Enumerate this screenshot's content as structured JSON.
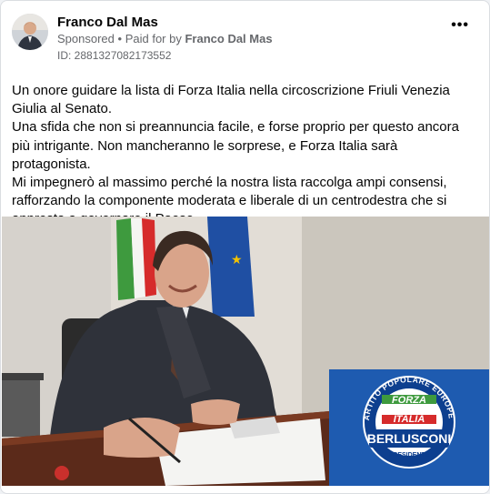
{
  "post": {
    "author": "Franco Dal Mas",
    "sponsored_label": "Sponsored",
    "separator": "•",
    "paid_for_label": "Paid for by",
    "paid_for_name": "Franco Dal Mas",
    "ad_id": "ID: 2881327082173552",
    "more_icon": "more-options-icon",
    "text_lines": [
      "Un onore guidare la lista di Forza Italia nella circoscrizione Friuli Venezia Giulia al Senato.",
      "Una sfida che non si preannuncia facile, e forse proprio per questo ancora più intrigante. Non mancheranno le sorprese, e Forza Italia sarà protagonista.",
      "Mi impegnerò al massimo perché la nostra lista raccolga ampi consensi, rafforzando la componente moderata e liberale di un centrodestra che si appresta a governare il Paese.…"
    ]
  },
  "logo": {
    "ring_text": "PARTITO POPOLARE EUROPEO",
    "forza": "FORZA",
    "italia": "ITALIA",
    "berlusconi": "BERLUSCONI",
    "presidente": "PRESIDENTE"
  },
  "colors": {
    "logo_bg": "#1e5bb0",
    "logo_ring": "#0d3f8f",
    "flag_green": "#3e9a3e",
    "flag_red": "#d62b2b",
    "eu_blue": "#1f4fa3"
  }
}
